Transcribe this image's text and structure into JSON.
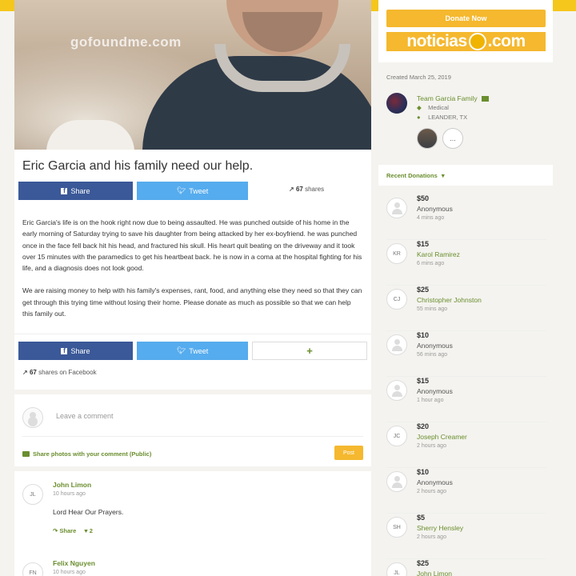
{
  "hero": {
    "watermark": "gofoundme.com"
  },
  "campaign": {
    "title": "Eric Garcia and his family need our help.",
    "story": [
      "Eric Garcia's life is on the hook right now due to being assaulted.  He was punched outside of his home in the early morning of Saturday trying to save his daughter from being attacked by her ex-boyfriend.  he was punched once in the face fell back hit his head, and fractured his skull.  His heart quit beating on the driveway and it took over 15 minutes with the paramedics to get his heartbeat back.  he is now in a coma at the hospital fighting for his life, and a diagnosis does not look good.",
      "We are raising money to help with his family's expenses, rant, food, and anything else they need so that they can get through this trying time without losing their home.  Please donate as much as possible so that we can help this family out."
    ]
  },
  "share": {
    "facebook_label": "Share",
    "twitter_label": "Tweet",
    "shares_count": "67",
    "shares_label": "shares",
    "plus_label": "+",
    "fb_shares_label": "shares on Facebook"
  },
  "comment_box": {
    "placeholder": "Leave a comment",
    "photo_note": "Share photos with your comment (Public)",
    "post_label": "Post"
  },
  "comments": [
    {
      "initials": "JL",
      "name": "John Limon",
      "time": "10 hours ago",
      "text": "Lord Hear Our Prayers.",
      "share_label": "Share",
      "likes": "2"
    },
    {
      "initials": "FN",
      "name": "Felix Nguyen",
      "time": "10 hours ago"
    }
  ],
  "sidebar": {
    "donate_label": "Donate Now",
    "noticias_banner": "noticias",
    "noticias_suffix": ".com",
    "created": "Created March 25, 2019",
    "organizer": {
      "name": "Team Garcia Family",
      "category": "Medical",
      "location": "LEANDER, TX",
      "more": "..."
    },
    "recent_donations_label": "Recent Donations"
  },
  "donations": [
    {
      "initials": "",
      "amount": "$50",
      "name": "Anonymous",
      "time": "4 mins ago",
      "named": false
    },
    {
      "initials": "KR",
      "amount": "$15",
      "name": "Karol Ramirez",
      "time": "6 mins ago",
      "named": true
    },
    {
      "initials": "CJ",
      "amount": "$25",
      "name": "Christopher Johnston",
      "time": "55 mins ago",
      "named": true
    },
    {
      "initials": "",
      "amount": "$10",
      "name": "Anonymous",
      "time": "56 mins ago",
      "named": false
    },
    {
      "initials": "",
      "amount": "$15",
      "name": "Anonymous",
      "time": "1 hour ago",
      "named": false
    },
    {
      "initials": "JC",
      "amount": "$20",
      "name": "Joseph Creamer",
      "time": "2 hours ago",
      "named": true
    },
    {
      "initials": "",
      "amount": "$10",
      "name": "Anonymous",
      "time": "2 hours ago",
      "named": false
    },
    {
      "initials": "SH",
      "amount": "$5",
      "name": "Sherry Hensley",
      "time": "2 hours ago",
      "named": true
    },
    {
      "initials": "JL",
      "amount": "$25",
      "name": "John Limon",
      "time": "",
      "named": true
    }
  ],
  "colors": {
    "brand_yellow": "#f5c61c",
    "accent_green": "#6a8e2e",
    "facebook": "#3b5998",
    "twitter": "#55acee",
    "button_orange": "#f5b82e"
  }
}
